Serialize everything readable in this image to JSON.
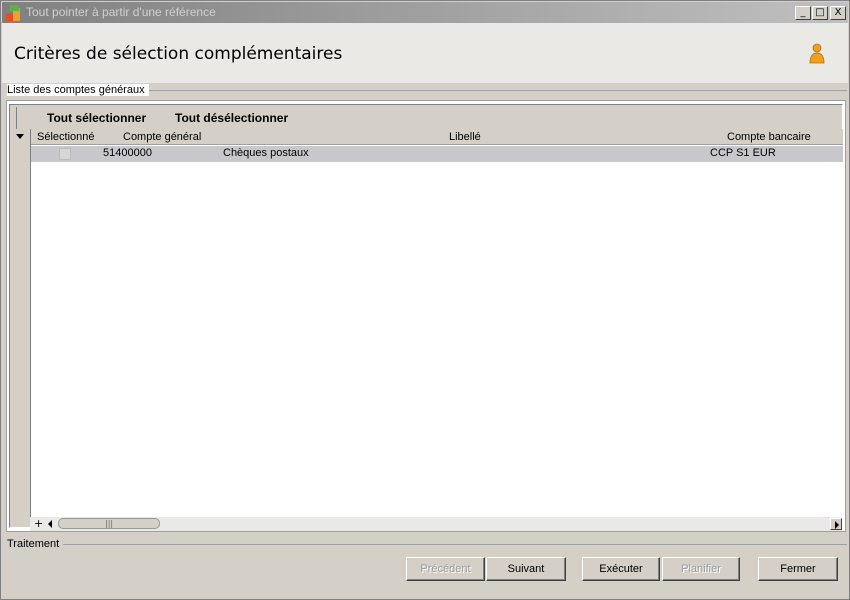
{
  "window": {
    "title": "Tout pointer à partir d'une référence",
    "controls": [
      "_",
      "□",
      "X"
    ]
  },
  "header": {
    "title": "Critères de sélection complémentaires",
    "icon": "person-icon"
  },
  "list_section": {
    "label": "Liste des comptes généraux",
    "toolbar": {
      "select_all": "Tout sélectionner",
      "deselect_all": "Tout désélectionner"
    },
    "columns": [
      "Sélectionné",
      "Compte général",
      "Libellé",
      "Compte bancaire"
    ],
    "rows": [
      {
        "selected": false,
        "account": "51400000",
        "label": "Chèques postaux",
        "bank_account": "CCP S1 EUR"
      }
    ],
    "scroll_plus": "+",
    "scroll_grip": "|||"
  },
  "process_section": {
    "label": "Traitement"
  },
  "buttons": {
    "previous": "Précédent",
    "next": "Suivant",
    "execute": "Exécuter",
    "schedule": "Planifier",
    "close": "Fermer"
  },
  "colors": {
    "selected_row": "#c8c8cc",
    "header_band": "#ebe9e6",
    "accent_person": "#f0a020"
  }
}
